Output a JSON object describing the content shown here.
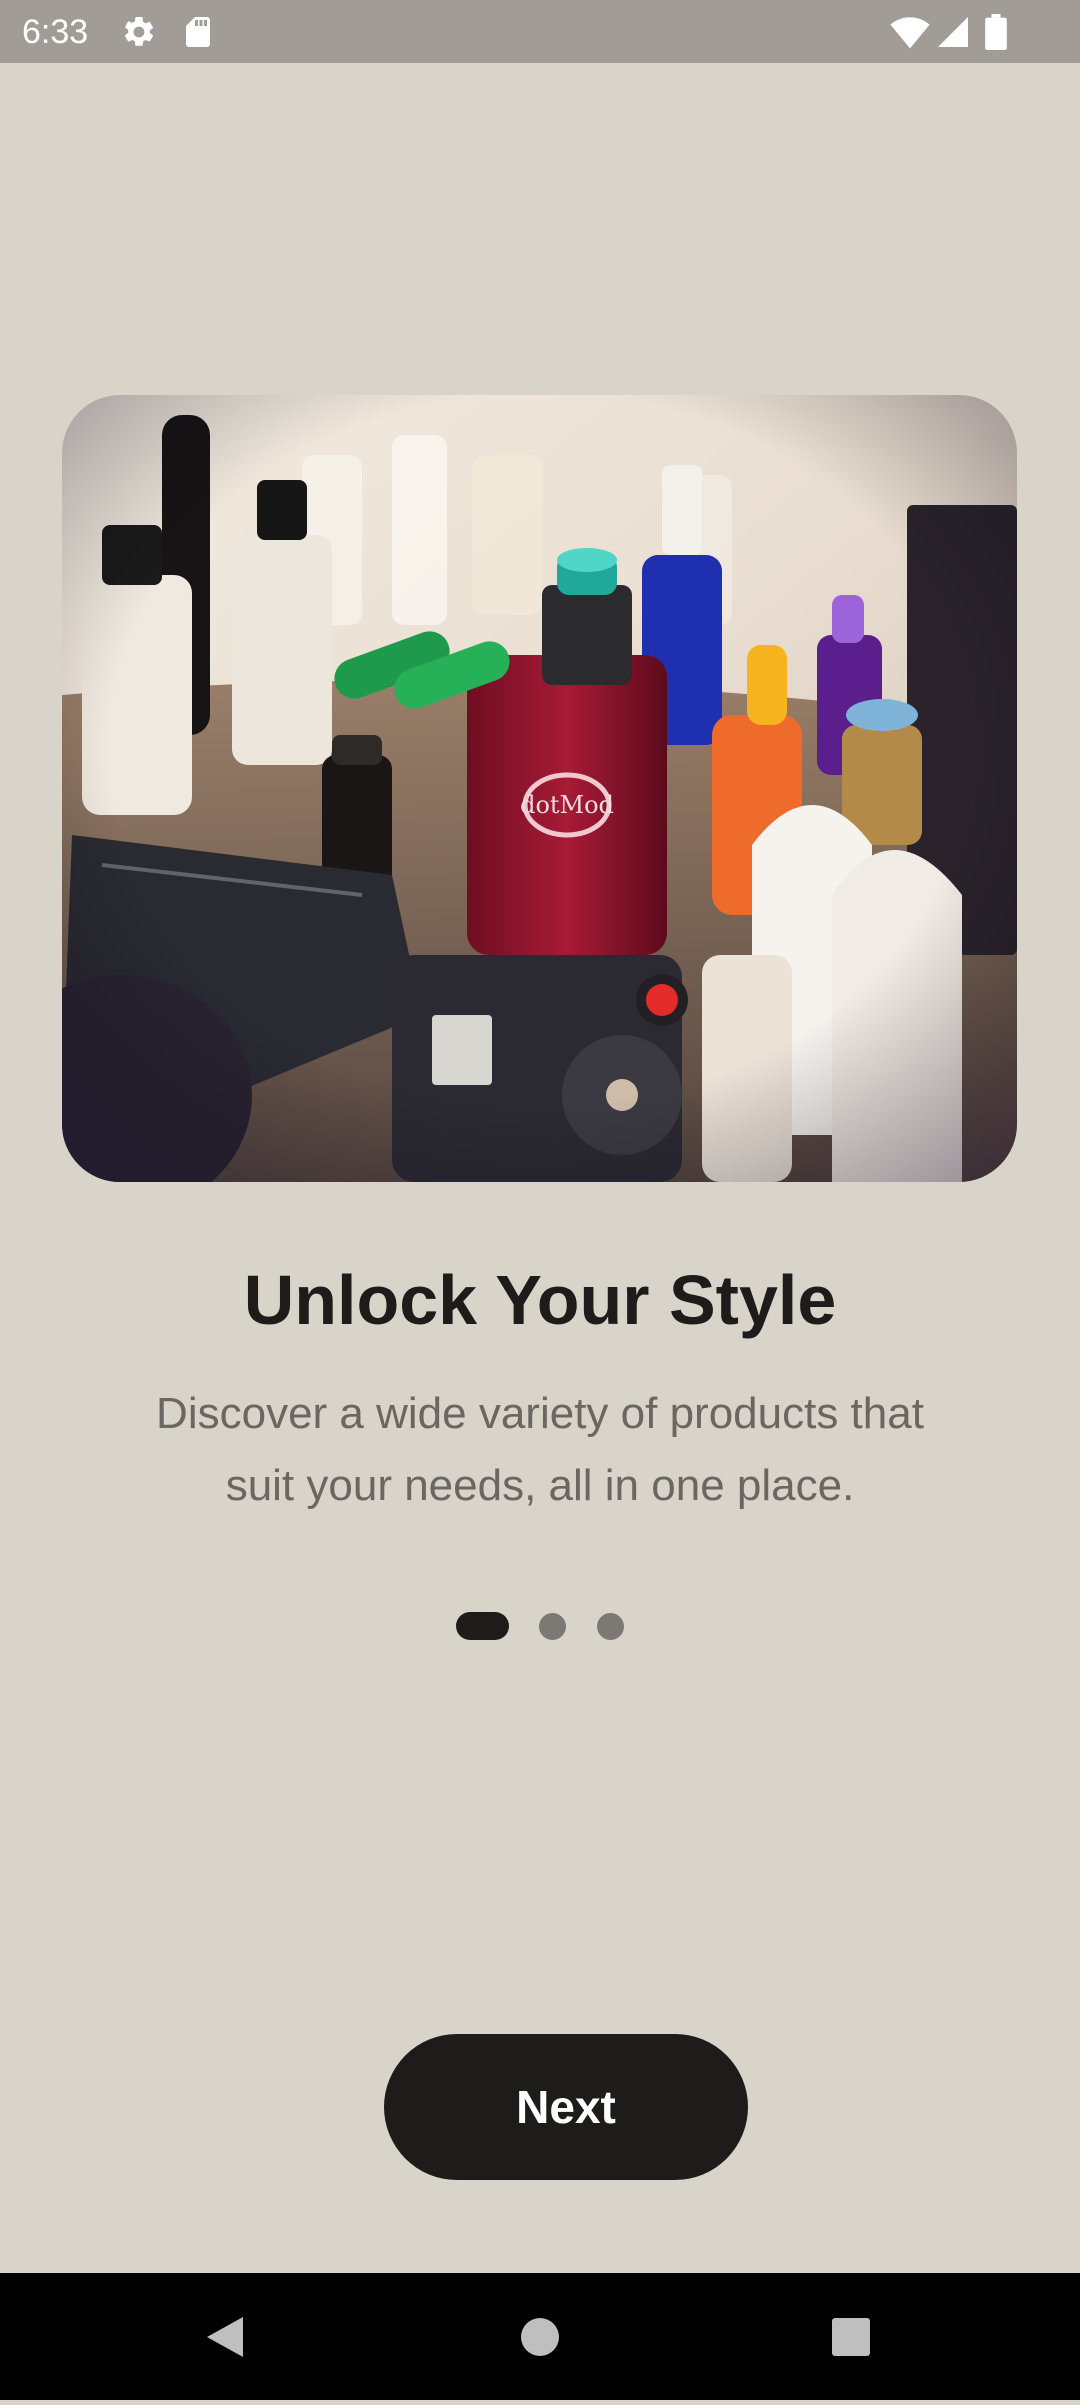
{
  "status_bar": {
    "time": "6:33",
    "icons": [
      "gear-icon",
      "sd-card-icon",
      "wifi-icon",
      "signal-icon",
      "battery-icon"
    ]
  },
  "onboarding": {
    "title": "Unlock Your Style",
    "description": "Discover a wide variety of products that suit your needs, all in one place.",
    "page_indicator": {
      "current": 1,
      "total": 3
    },
    "next_label": "Next"
  },
  "nav_bar": {
    "buttons": [
      "back-icon",
      "home-icon",
      "recents-icon"
    ]
  },
  "colors": {
    "background": "#d9d4c9",
    "primary": "#1d1c1a",
    "secondary_text": "#6a6762",
    "status_bar": "#a19d96"
  }
}
